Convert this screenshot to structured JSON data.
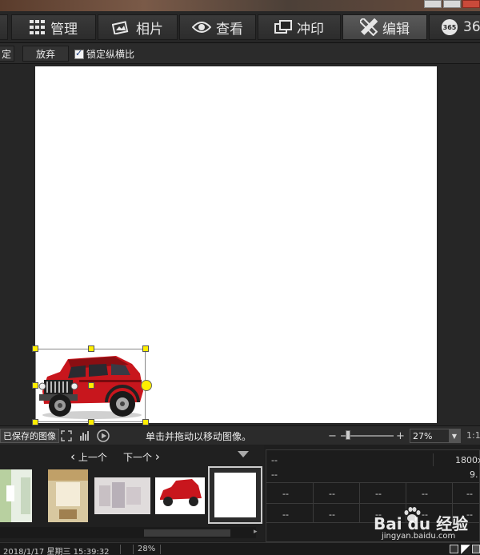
{
  "nav": {
    "prev_partial": "0",
    "tabs": [
      {
        "label": "管理",
        "icon": "grid-icon"
      },
      {
        "label": "相片",
        "icon": "photo-icon"
      },
      {
        "label": "查看",
        "icon": "eye-icon"
      },
      {
        "label": "冲印",
        "icon": "print-icon"
      },
      {
        "label": "编辑",
        "icon": "pencil-ruler-icon",
        "active": true
      },
      {
        "label": "365",
        "icon": "365-icon"
      }
    ]
  },
  "toolbar": {
    "confirm_label": "定",
    "discard_label": "放弃",
    "lock_ratio_label": "锁定纵横比"
  },
  "status": {
    "saved_image_label": "已保存的图像",
    "hint": "单击并拖动以移动图像。",
    "zoom_value": "27%",
    "ratio_label": "1:1"
  },
  "filmstrip": {
    "prev_label": "上一个",
    "next_label": "下一个"
  },
  "info": {
    "row1_left": "--",
    "row1_right": "1800x",
    "row2_left": "--",
    "row2_right": "9.",
    "cells_row3": [
      "--",
      "--",
      "--",
      "--",
      "--"
    ],
    "cells_row4": [
      "--",
      "--",
      "--",
      "--",
      "--"
    ]
  },
  "bottom": {
    "datetime": "2018/1/17 星期三 15:39:32",
    "zoom_percent": "28%"
  },
  "watermark": {
    "brand": "Bai du 经验",
    "url": "jingyan.baidu.com"
  },
  "colors": {
    "handle": "#ffee00",
    "active_tab": "#4a4a4a",
    "canvas": "#ffffff"
  }
}
